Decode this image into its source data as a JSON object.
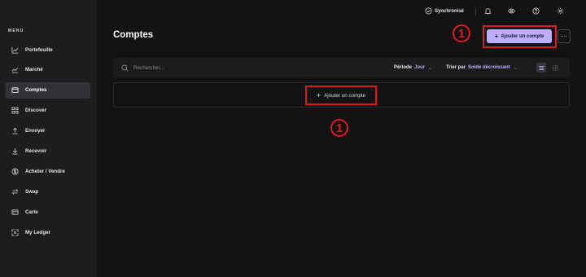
{
  "colors": {
    "accent": "#bbb0ff",
    "highlight": "#e0191c",
    "sidebar_bg": "#1c1d1f",
    "main_bg": "#131214"
  },
  "sidebar": {
    "menu_label": "MENU",
    "items": [
      {
        "label": "Portefeuille",
        "icon": "chart-line-icon"
      },
      {
        "label": "Marché",
        "icon": "market-chart-icon"
      },
      {
        "label": "Comptes",
        "icon": "wallet-icon",
        "active": true
      },
      {
        "label": "Discover",
        "icon": "grid-icon"
      },
      {
        "label": "Envoyer",
        "icon": "arrow-up-icon"
      },
      {
        "label": "Recevoir",
        "icon": "arrow-down-icon"
      },
      {
        "label": "Acheter / Vendre",
        "icon": "dollar-icon"
      },
      {
        "label": "Swap",
        "icon": "swap-icon"
      },
      {
        "label": "Carte",
        "icon": "card-icon"
      },
      {
        "label": "My Ledger",
        "icon": "ledger-icon"
      }
    ]
  },
  "topbar": {
    "sync_label": "Synchronisé",
    "icons": [
      "bell-icon",
      "eye-icon",
      "help-icon",
      "settings-icon"
    ]
  },
  "page": {
    "title": "Comptes",
    "add_account_button": "Ajouter un compte",
    "more_button": "···",
    "step_number": "1"
  },
  "toolbar": {
    "search_placeholder": "Rechercher...",
    "period_label": "Période",
    "period_value": "Jour",
    "sort_label": "Trier par",
    "sort_value": "Solde décroissant"
  },
  "empty_state": {
    "add_account_label": "Ajouter un compte"
  }
}
